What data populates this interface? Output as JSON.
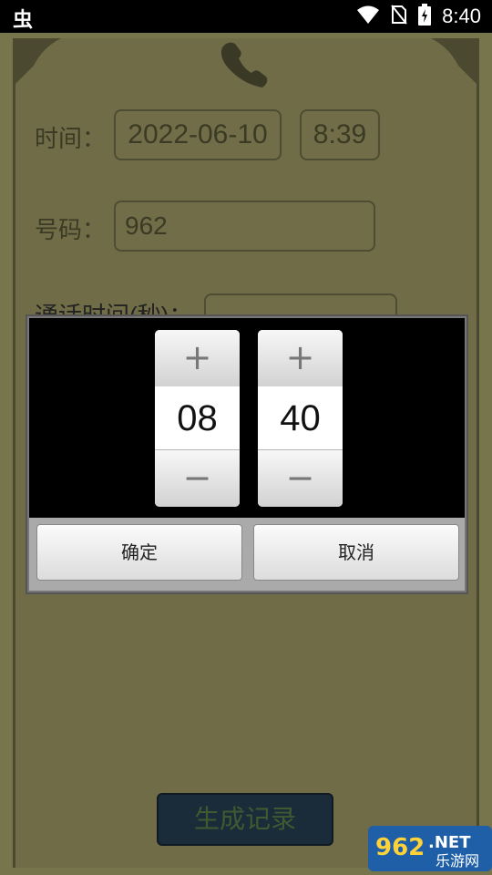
{
  "statusbar": {
    "left_glyph": "虫",
    "time": "8:40",
    "icons": [
      "wifi-icon",
      "no-sim-icon",
      "battery-charging-icon"
    ]
  },
  "form": {
    "time_label": "时间：",
    "date_value": "2022-06-10",
    "time_value": "8:39",
    "number_label": "号码：",
    "number_value": "962",
    "duration_label": "通话时间(秒)："
  },
  "generate_button": "生成记录",
  "time_picker": {
    "hours": "08",
    "minutes": "40",
    "plus": "+",
    "minus": "−",
    "ok_label": "确定",
    "cancel_label": "取消"
  },
  "watermark": {
    "brand": "962",
    "suffix": ".NET",
    "site": "乐游网"
  },
  "colors": {
    "app_background": "#77754c",
    "text_dark": "#3b3a24",
    "dialog_black": "#000000",
    "button_face": "#eeeeee"
  }
}
